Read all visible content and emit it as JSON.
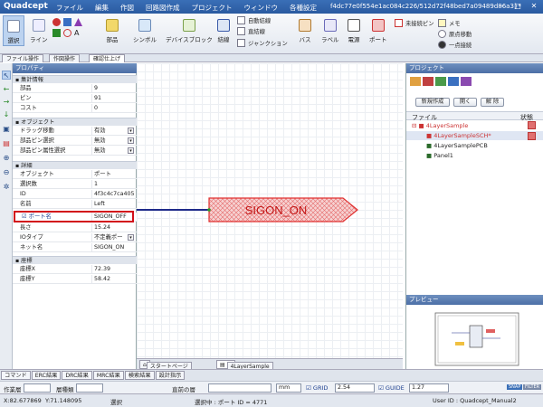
{
  "app": {
    "logo": "Quadcept",
    "doc_title": "f4dc77e0f554e1ac084c226/512d72f48bed7a09489d86a3}*",
    "win_buttons": [
      "‒",
      "□",
      "✕"
    ]
  },
  "menu": [
    "ファイル",
    "編集",
    "作図",
    "回路図作成",
    "プロジェクト",
    "ウィンドウ",
    "各種設定"
  ],
  "ribbon": {
    "select": "選択",
    "line": "ライン",
    "parts": "部品",
    "symbol": "シンボル",
    "device_block": "デバイスブロック",
    "wire": "結線",
    "auto_wire": "自動結線",
    "direct_wire": "直結線",
    "junction": "ジャンクション",
    "bus": "バス",
    "label": "ラベル",
    "power": "電源",
    "port": "ポート",
    "no_connect_pin": "未接続ピン",
    "memo": "メモ",
    "origin_move": "原点移動",
    "single_point": "一点接続"
  },
  "tabs": {
    "file_ops": "ファイル操作",
    "draw_ops": "作図操作",
    "confirm": "確認仕上げ"
  },
  "properties": {
    "title": "プロパティ",
    "sections": {
      "totals": "集計情報",
      "object": "オブジェクト",
      "detail": "詳細",
      "coord": "座標"
    },
    "totals": [
      {
        "k": "部品",
        "v": "9"
      },
      {
        "k": "ピン",
        "v": "91"
      },
      {
        "k": "コスト",
        "v": "0"
      }
    ],
    "object": [
      {
        "k": "ドラッグ移動",
        "v": "有効"
      },
      {
        "k": "部品ピン選択",
        "v": "無効"
      },
      {
        "k": "部品ピン属性選択",
        "v": "無効"
      }
    ],
    "detail": [
      {
        "k": "オブジェクト",
        "v": "ポート"
      },
      {
        "k": "選択数",
        "v": "1"
      },
      {
        "k": "ID",
        "v": "4f3c4c7ca405"
      },
      {
        "k": "名前",
        "v": "Left"
      },
      {
        "k": "ポート名",
        "v": "SIGON_OFF"
      },
      {
        "k": "長さ",
        "v": "15.24"
      },
      {
        "k": "IOタイプ",
        "v": "不定義ポー"
      },
      {
        "k": "ネット名",
        "v": "SIGON_ON"
      }
    ],
    "coord": [
      {
        "k": "座標X",
        "v": "72.39"
      },
      {
        "k": "座標Y",
        "v": "58.42"
      }
    ]
  },
  "canvas": {
    "port_label": "SIGON_ON"
  },
  "doc_tabs": {
    "start": "スタートページ",
    "sheet": "4LayerSample"
  },
  "project": {
    "title": "プロジェクト",
    "new_btn": "新規作成",
    "open_btn": "開く",
    "close_btn": "解 除",
    "col_file": "ファイル",
    "col_status": "状態",
    "tree": [
      {
        "name": "4LayerSample",
        "level": 0,
        "color": "#d23030"
      },
      {
        "name": "4LayerSampleSCH*",
        "level": 1,
        "color": "#d23030"
      },
      {
        "name": "4LayerSamplePCB",
        "level": 1,
        "color": "#2a6a2a"
      },
      {
        "name": "Panel1",
        "level": 1,
        "color": "#2a6a2a"
      }
    ]
  },
  "preview": {
    "title": "プレビュー"
  },
  "bottom_tabs": [
    "コマンド",
    "ERC結果",
    "DRC結果",
    "MRC結果",
    "検索結果",
    "設計指示"
  ],
  "layerbar": {
    "work_layer": "作業層",
    "layer_type": "層種類",
    "prev_layer": "直前の層",
    "unit": "mm",
    "grid_label": "GRID",
    "grid_value": "2.54",
    "guide_label": "GUIDE",
    "guide_value": "1.27",
    "snap": "SNAP",
    "filter": "FILTER"
  },
  "status": {
    "x": "X:82.677869",
    "y": "Y:71.148095",
    "mode": "選択",
    "selection": "選択中 : ポート ID = 4771",
    "user": "User ID : Quadcept_Manual2"
  },
  "colors": {
    "accent": "#2a5aa0",
    "port_fill": "#f3c4c4",
    "port_stroke": "#e03030",
    "wire": "#1e2a8a",
    "highlight": "#d2101a"
  }
}
